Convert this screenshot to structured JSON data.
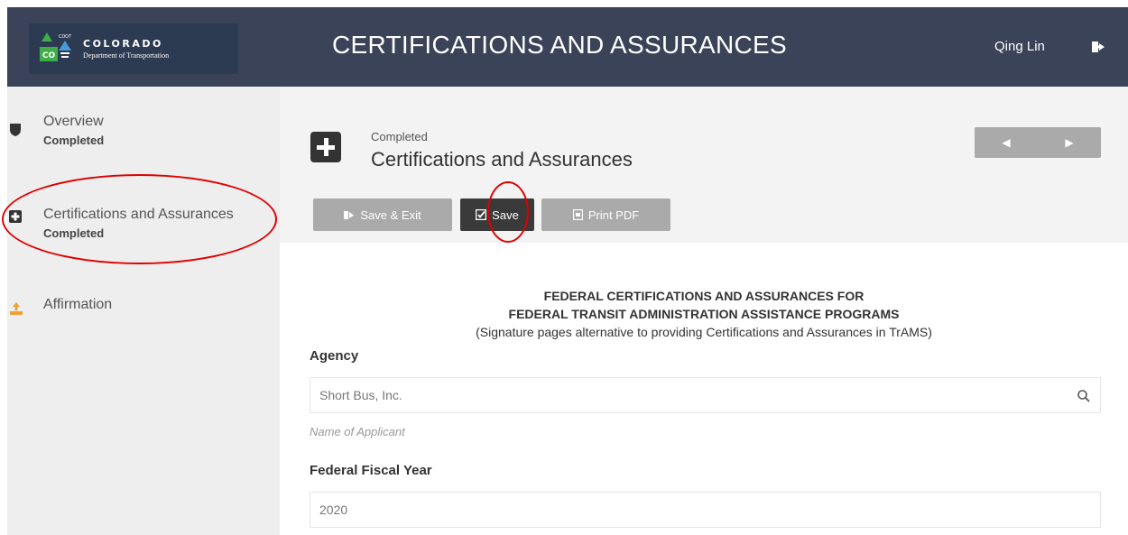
{
  "header": {
    "logo_title": "COLORADO",
    "logo_subtitle": "Department of Transportation",
    "logo_badge_small": "CDOT",
    "logo_badge_letters": "CO",
    "page_title": "CERTIFICATIONS AND ASSURANCES",
    "user_name": "Qing Lin",
    "logout_icon": "sign-out-icon"
  },
  "sidebar": {
    "items": [
      {
        "label": "Overview",
        "status": "Completed",
        "icon": "shield-icon"
      },
      {
        "label": "Certifications and Assurances",
        "status": "Completed",
        "icon": "plus-square-icon"
      },
      {
        "label": "Affirmation",
        "status": "",
        "icon": "download-tray-icon"
      }
    ]
  },
  "section": {
    "status": "Completed",
    "title": "Certifications and Assurances",
    "icon": "plus-square-icon"
  },
  "toolbar": {
    "save_exit_label": "Save & Exit",
    "save_label": "Save",
    "print_label": "Print PDF"
  },
  "document": {
    "heading_line1": "FEDERAL CERTIFICATIONS AND ASSURANCES FOR",
    "heading_line2": "FEDERAL TRANSIT ADMINISTRATION ASSISTANCE PROGRAMS",
    "subheading": "(Signature pages alternative to providing Certifications and Assurances in TrAMS)"
  },
  "form": {
    "agency_label": "Agency",
    "agency_value": "Short Bus, Inc.",
    "agency_helper": "Name of Applicant",
    "fiscal_year_label": "Federal Fiscal Year",
    "fiscal_year_value": "2020"
  },
  "colors": {
    "header_bg": "#3a4358",
    "sidebar_bg": "#eeeeee",
    "highlight_ring": "#e00000",
    "primary_button": "#3a3a3a",
    "disabled_button": "#aaaaaa"
  }
}
